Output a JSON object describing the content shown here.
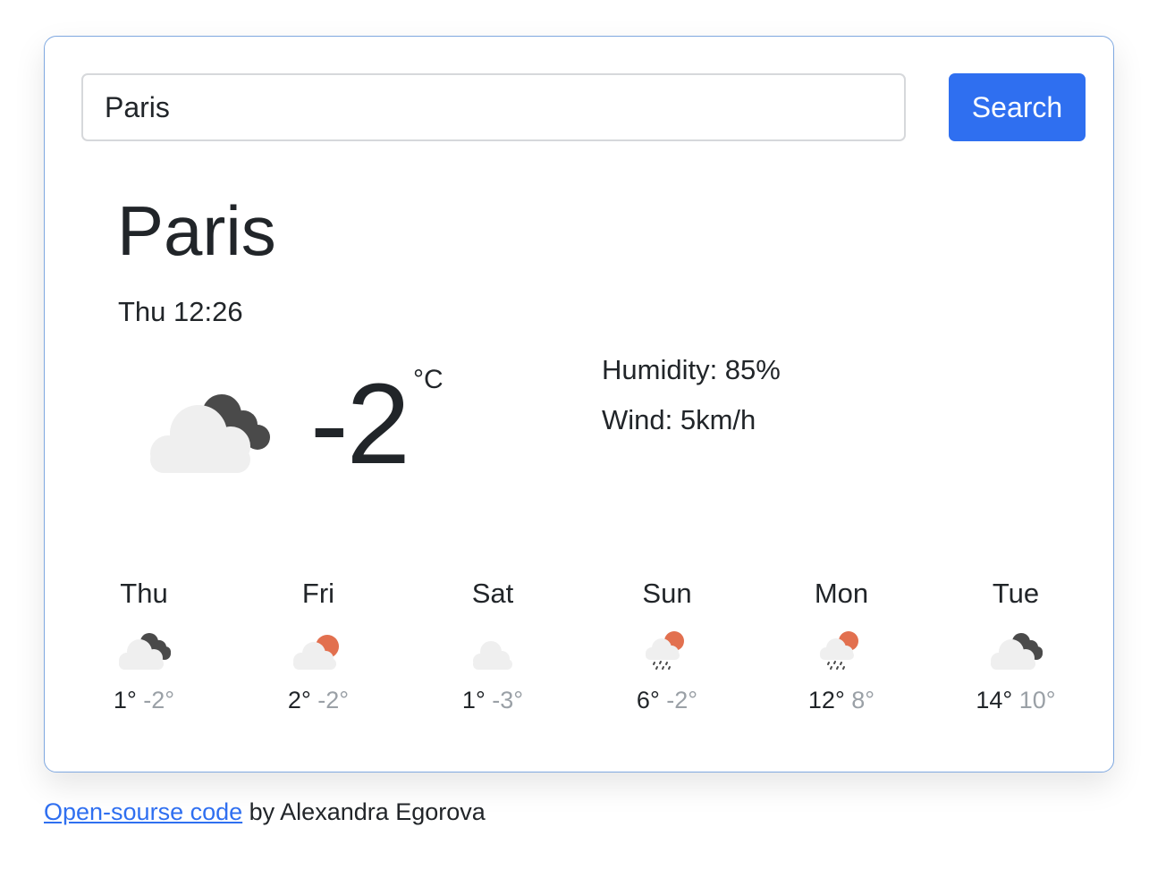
{
  "search": {
    "value": "Paris",
    "button_label": "Search"
  },
  "current": {
    "city": "Paris",
    "datetime": "Thu 12:26",
    "temperature": "-2",
    "unit": "°C",
    "icon": "cloudy-dark-cloud-icon",
    "humidity_text": "Humidity: 85%",
    "wind_text": "Wind: 5km/h"
  },
  "forecast": [
    {
      "day": "Thu",
      "max": "1°",
      "min": "-2°",
      "icon": "cloudy-dark-cloud-icon"
    },
    {
      "day": "Fri",
      "max": "2°",
      "min": "-2°",
      "icon": "partly-cloudy-sun-icon"
    },
    {
      "day": "Sat",
      "max": "1°",
      "min": "-3°",
      "icon": "cloud-icon"
    },
    {
      "day": "Sun",
      "max": "6°",
      "min": "-2°",
      "icon": "rain-sun-cloud-icon"
    },
    {
      "day": "Mon",
      "max": "12°",
      "min": "8°",
      "icon": "rain-sun-cloud-icon"
    },
    {
      "day": "Tue",
      "max": "14°",
      "min": "10°",
      "icon": "cloudy-dark-cloud-icon"
    }
  ],
  "footer": {
    "link_text": "Open-sourse code",
    "suffix": " by Alexandra Egorova"
  },
  "colors": {
    "accent": "#2f6ff0",
    "card_border": "#7fa8e0",
    "sun": "#e2704f",
    "dark_cloud": "#4a4a4a",
    "light_cloud": "#efefef",
    "muted": "#9aa0a6"
  }
}
